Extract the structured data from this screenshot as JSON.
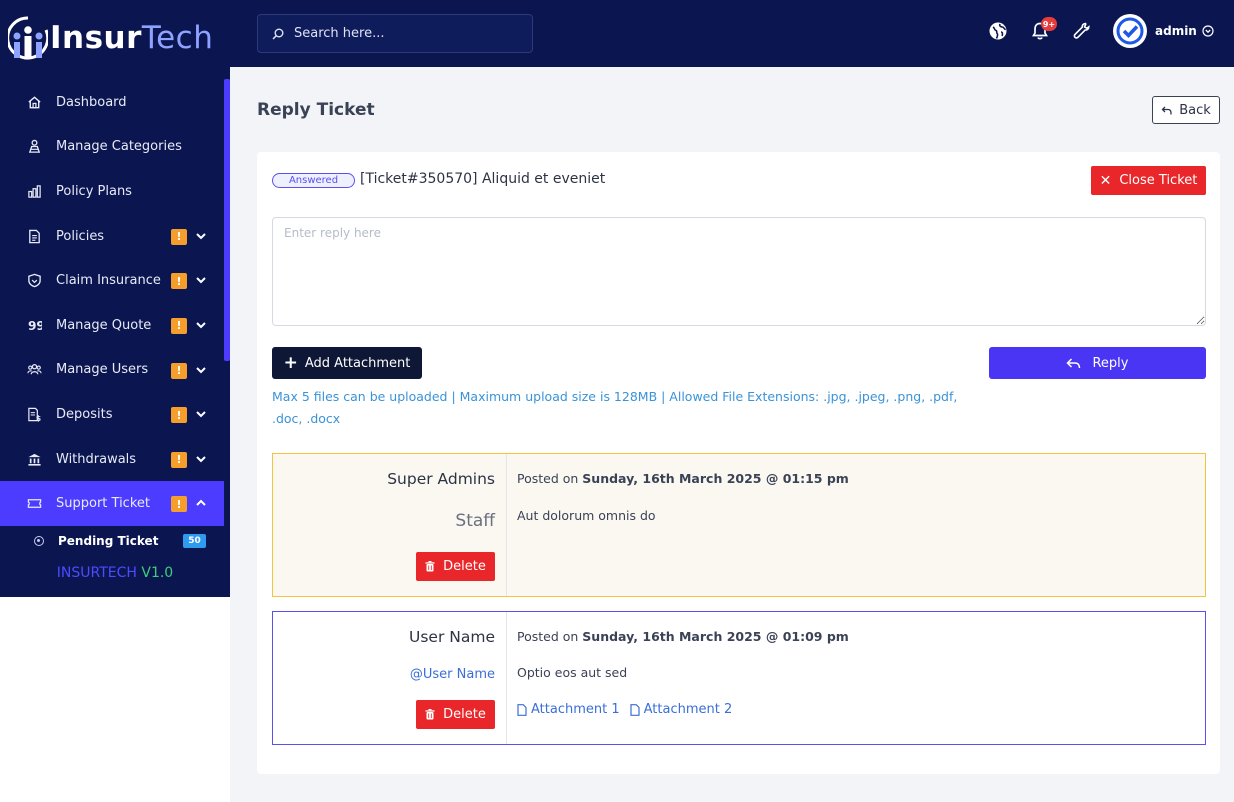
{
  "brand": {
    "name_bold": "Insur",
    "name_thin": "Tech"
  },
  "sidebar": {
    "items": [
      {
        "label": "Dashboard",
        "icon": "home-icon",
        "badge": "",
        "chevron": ""
      },
      {
        "label": "Manage Categories",
        "icon": "categories-icon",
        "badge": "",
        "chevron": ""
      },
      {
        "label": "Policy Plans",
        "icon": "chart-icon",
        "badge": "",
        "chevron": ""
      },
      {
        "label": "Policies",
        "icon": "document-icon",
        "badge": "!",
        "chevron": "down"
      },
      {
        "label": "Claim Insurance",
        "icon": "shield-icon",
        "badge": "!",
        "chevron": "down"
      },
      {
        "label": "Manage Quote",
        "icon": "quote-icon",
        "badge": "!",
        "chevron": "down"
      },
      {
        "label": "Manage Users",
        "icon": "users-icon",
        "badge": "!",
        "chevron": "down"
      },
      {
        "label": "Deposits",
        "icon": "deposit-icon",
        "badge": "!",
        "chevron": "down"
      },
      {
        "label": "Withdrawals",
        "icon": "bank-icon",
        "badge": "!",
        "chevron": "down"
      },
      {
        "label": "Support Ticket",
        "icon": "ticket-icon",
        "badge": "!",
        "chevron": "up"
      }
    ],
    "sub_item": {
      "label": "Pending Ticket",
      "count": "50"
    },
    "version_name": "INSURTECH",
    "version_number": "V1.0"
  },
  "topbar": {
    "search_placeholder": "Search here...",
    "notification_count": "9+",
    "user_name": "admin"
  },
  "page": {
    "title": "Reply Ticket",
    "back_label": "Back"
  },
  "ticket": {
    "status": "Answered",
    "title": "[Ticket#350570] Aliquid et eveniet",
    "close_label": "Close Ticket",
    "reply_placeholder": "Enter reply here",
    "attach_label": "Add Attachment",
    "reply_label": "Reply",
    "upload_info": "Max 5 files can be uploaded | Maximum upload size is 128MB | Allowed File Extensions: .jpg, .jpeg, .png, .pdf, .doc, .docx"
  },
  "messages": [
    {
      "author": "Super Admins",
      "role": "Staff",
      "posted_prefix": "Posted on ",
      "posted_date": "Sunday, 16th March 2025 @ 01:15 pm",
      "body": "Aut dolorum omnis do",
      "delete_label": "Delete"
    },
    {
      "author": "User Name",
      "handle": "@User Name",
      "posted_prefix": "Posted on ",
      "posted_date": "Sunday, 16th March 2025 @ 01:09 pm",
      "body": "Optio eos aut sed",
      "delete_label": "Delete",
      "attachments": [
        "Attachment 1",
        "Attachment 2"
      ]
    }
  ],
  "colors": {
    "sidebar_bg": "#0b1650",
    "accent": "#4b35f5",
    "danger": "#e9262a",
    "warning_badge": "#f59e2b",
    "admin_border": "#f3c43c",
    "user_border": "#5b4ff0"
  }
}
